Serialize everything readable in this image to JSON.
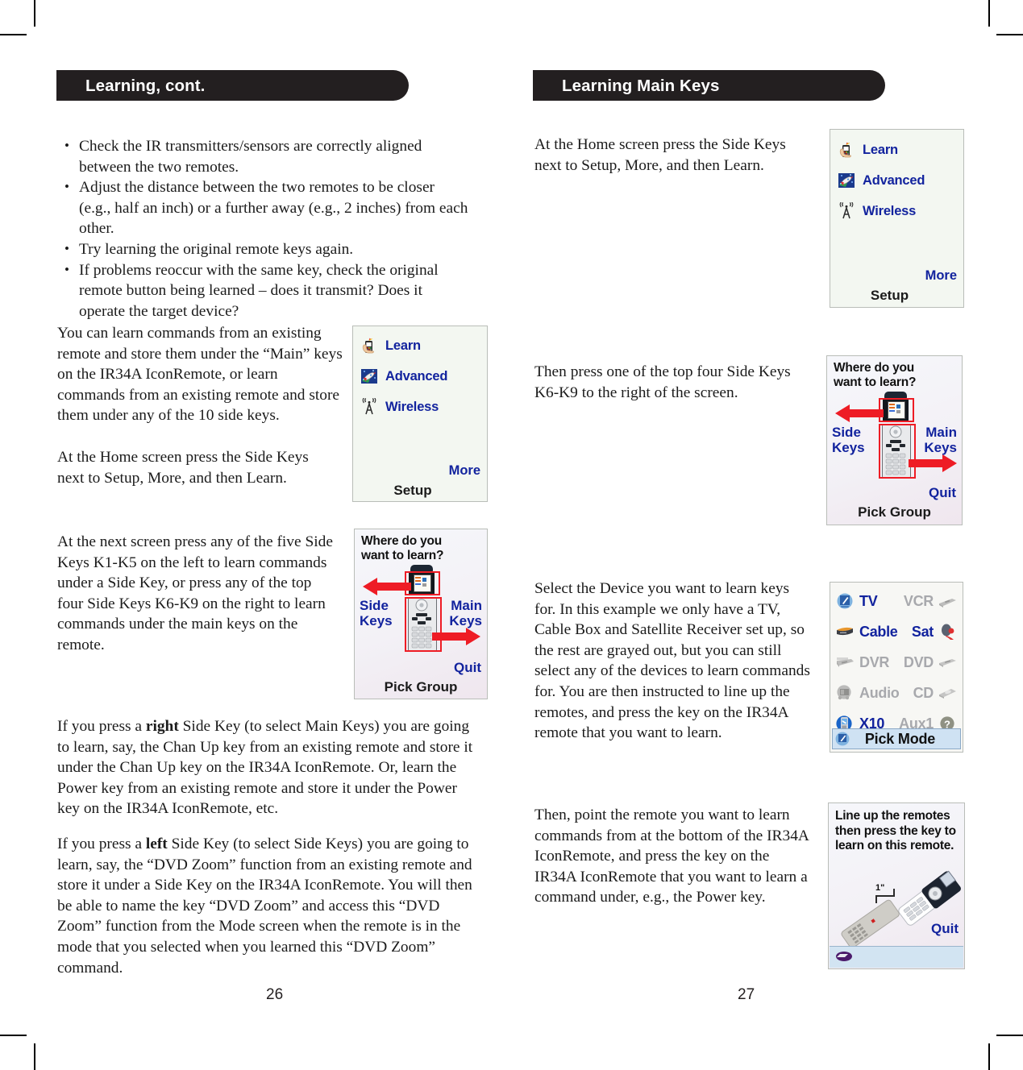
{
  "document": {
    "page_numbers": {
      "left": "26",
      "right": "27"
    }
  },
  "left_page": {
    "header": "Learning, cont.",
    "bullets": [
      "Check the IR transmitters/sensors are correctly aligned between the two remotes.",
      "Adjust the distance between the two remotes to be closer (e.g., half an inch) or a further away (e.g., 2 inches) from each other.",
      "Try learning the original remote keys again.",
      "If problems reoccur with the same key, check the original remote button being learned – does it transmit? Does it operate the target device?"
    ],
    "para_1": "You can learn commands from an existing remote and store them under the “Main” keys on the IR34A IconRemote, or learn commands from an existing remote and store them under any of the 10 side keys.",
    "para_2": "At the Home screen press the Side Keys next to Setup, More, and then Learn.",
    "para_3": "At the next screen press any of the five Side Keys K1-K5 on the left to learn commands under a Side Key, or press any of the top four Side Keys K6-K9 on the right to learn commands under the main keys on the remote.",
    "para_4_a": "If you press a ",
    "para_4_bold": "right",
    "para_4_b": " Side Key (to select Main Keys) you are going to learn, say, the Chan Up key from an existing remote and store it under the Chan Up key on the IR34A IconRemote. Or, learn the Power key from an existing remote and store it under the Power key on the IR34A IconRemote, etc.",
    "para_5_a": "If you press a ",
    "para_5_bold": "left",
    "para_5_b": " Side Key (to select Side Keys) you are going to learn, say, the “DVD Zoom” function from an existing remote and store it under a Side Key on the IR34A IconRemote. You will then be able to name the key “DVD Zoom” and access this “DVD Zoom” function from the Mode screen when the remote is in the mode that you selected when you learned this “DVD Zoom” command."
  },
  "right_page": {
    "header": "Learning Main Keys",
    "para_1": "At the Home screen press the Side Keys next to Setup, More, and then Learn.",
    "para_2": "Then press one of the top four Side Keys K6-K9 to the right of the screen.",
    "para_3": "Select the Device you want to learn keys for. In this example we only have a TV, Cable Box and Satellite Receiver set up, so the rest are grayed out, but you can still select any of the devices to learn commands for. You are then instructed to line up the remotes, and press the key on the IR34A remote that you want to learn.",
    "para_4": "Then, point the remote you want to learn commands from at the bottom of the IR34A IconRemote, and press the key on the IR34A IconRemote that you want to learn a command under, e.g., the Power key."
  },
  "screens": {
    "setup_menu": {
      "items": [
        {
          "label": "Learn",
          "icon": "hand-remote-icon"
        },
        {
          "label": "Advanced",
          "icon": "rocket-icon"
        },
        {
          "label": "Wireless",
          "icon": "antenna-icon"
        }
      ],
      "soft_key_right": "More",
      "soft_key_bottom": "Setup"
    },
    "where_learn": {
      "title": "Where do you want to learn?",
      "left_label": "Side Keys",
      "right_label": "Main Keys",
      "quit": "Quit",
      "bottom": "Pick Group"
    },
    "device_picker": {
      "rows": [
        {
          "left": {
            "label": "TV",
            "enabled": true,
            "icon": "tv-icon"
          },
          "right": {
            "label": "VCR",
            "enabled": false,
            "icon": "vcr-icon"
          }
        },
        {
          "left": {
            "label": "Cable",
            "enabled": true,
            "icon": "cable-box-icon"
          },
          "right": {
            "label": "Sat",
            "enabled": true,
            "icon": "satellite-dish-icon"
          }
        },
        {
          "left": {
            "label": "DVR",
            "enabled": false,
            "icon": "dvr-icon"
          },
          "right": {
            "label": "DVD",
            "enabled": false,
            "icon": "dvd-player-icon"
          }
        },
        {
          "left": {
            "label": "Audio",
            "enabled": false,
            "icon": "audio-receiver-icon"
          },
          "right": {
            "label": "CD",
            "enabled": false,
            "icon": "cd-player-icon"
          }
        },
        {
          "left": {
            "label": "X10",
            "enabled": true,
            "icon": "x10-icon"
          },
          "right": {
            "label": "Aux1",
            "enabled": false,
            "icon": "question-mark-icon"
          }
        }
      ],
      "bottom_bar": "Pick Mode"
    },
    "line_up": {
      "title": "Line up the remotes then press the key to learn on this remote.",
      "dimension": "1\"",
      "quit": "Quit"
    }
  },
  "colors": {
    "header_bar": "#231f20",
    "lcd_text_blue": "#12239e",
    "lcd_disabled": "#a8a9ad",
    "arrow_red": "#ee1c25",
    "lcd_background": "#f3f7f1",
    "pick_mode_bar": "#cfe2f3"
  }
}
